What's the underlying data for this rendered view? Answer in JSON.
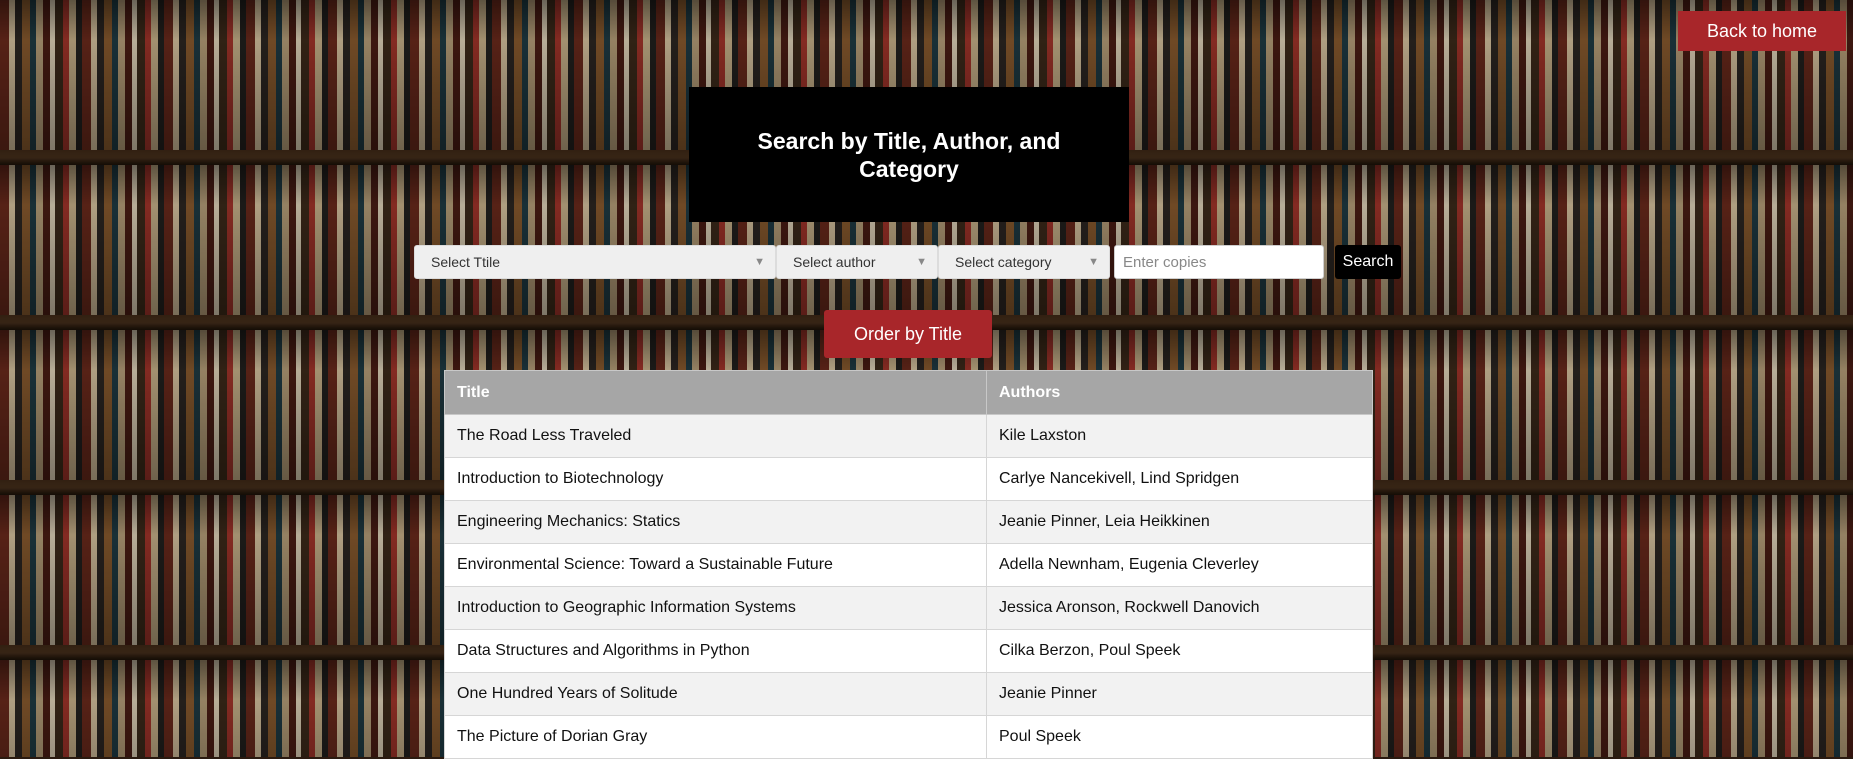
{
  "nav": {
    "back_label": "Back to home"
  },
  "header": {
    "title": "Search by Title, Author, and Category"
  },
  "filters": {
    "title_select": "Select Ttile",
    "author_select": "Select author",
    "category_select": "Select category",
    "copies_placeholder": "Enter copies",
    "search_label": "Search"
  },
  "order_label": "Order by Title",
  "table": {
    "headers": [
      "Title",
      "Authors"
    ],
    "rows": [
      [
        "The Road Less Traveled",
        "Kile Laxston"
      ],
      [
        "Introduction to Biotechnology",
        "Carlye Nancekivell, Lind Spridgen"
      ],
      [
        "Engineering Mechanics: Statics",
        "Jeanie Pinner, Leia Heikkinen"
      ],
      [
        "Environmental Science: Toward a Sustainable Future",
        "Adella Newnham, Eugenia Cleverley"
      ],
      [
        "Introduction to Geographic Information Systems",
        "Jessica Aronson, Rockwell Danovich"
      ],
      [
        "Data Structures and Algorithms in Python",
        "Cilka Berzon, Poul Speek"
      ],
      [
        "One Hundred Years of Solitude",
        "Jeanie Pinner"
      ],
      [
        "The Picture of Dorian Gray",
        "Poul Speek"
      ]
    ]
  },
  "colors": {
    "accent": "#a8262a",
    "header_bg": "#000000",
    "table_header": "#a6a6a6"
  }
}
